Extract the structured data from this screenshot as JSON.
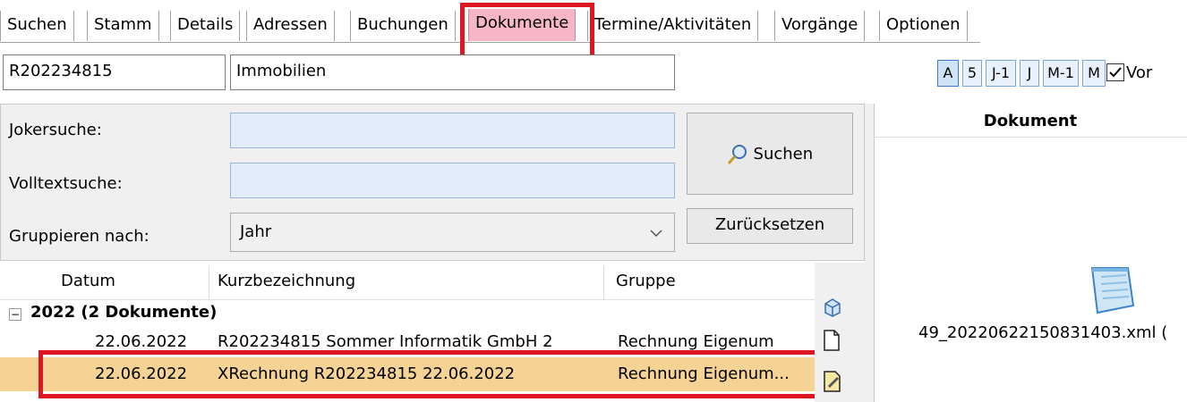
{
  "tabs": [
    {
      "label": "Suchen"
    },
    {
      "label": "Stamm"
    },
    {
      "label": "Details"
    },
    {
      "label": "Adressen"
    },
    {
      "label": "Buchungen"
    },
    {
      "label": "Dokumente"
    },
    {
      "label": "Termine/Aktivitäten"
    },
    {
      "label": "Vorgänge"
    },
    {
      "label": "Optionen"
    }
  ],
  "header": {
    "number": "R202234815",
    "name": "Immobilien"
  },
  "period_buttons": [
    {
      "label": "A"
    },
    {
      "label": "5"
    },
    {
      "label": "J-1"
    },
    {
      "label": "J"
    },
    {
      "label": "M-1"
    },
    {
      "label": "M"
    }
  ],
  "vor_checkbox_label": "Vor",
  "search": {
    "joker_label": "Jokersuche:",
    "volltext_label": "Volltextsuche:",
    "group_label": "Gruppieren nach:",
    "group_value": "Jahr",
    "search_button": "Suchen",
    "reset_button": "Zurücksetzen"
  },
  "table": {
    "columns": [
      "Datum",
      "Kurzbezeichnung",
      "Gruppe"
    ],
    "group_header": "2022 (2 Dokumente)",
    "rows": [
      {
        "date": "22.06.2022",
        "title": "R202234815 Sommer Informatik GmbH 2",
        "group": "Rechnung Eigenum"
      },
      {
        "date": "22.06.2022",
        "title": "XRechnung R202234815 22.06.2022",
        "group": "Rechnung Eigenum..."
      }
    ]
  },
  "preview": {
    "header": "Dokument",
    "filename": "49_20220622150831403.xml ("
  },
  "colors": {
    "highlight_red": "#e01522",
    "active_tab": "#f7b6c8",
    "selected_row": "#f5d394",
    "input_blue": "#e3ecfc"
  }
}
